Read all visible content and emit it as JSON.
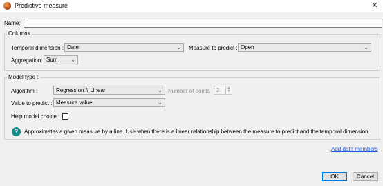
{
  "window": {
    "title": "Predictive measure",
    "close_glyph": "✕"
  },
  "name": {
    "label": "Name:",
    "value": ""
  },
  "columns": {
    "title": "Columns",
    "temporal_dimension_label": "Temporal dimension :",
    "temporal_dimension_value": "Date",
    "measure_to_predict_label": "Measure to predict :",
    "measure_to_predict_value": "Open",
    "aggregation_label": "Aggregation:",
    "aggregation_value": "Sum"
  },
  "model": {
    "title": "Model type :",
    "algorithm_label": "Algorithm :",
    "algorithm_value": "Regression // Linear",
    "points_label": "Number of points",
    "points_value": "2",
    "value_to_predict_label": "Value to predict :",
    "value_to_predict_value": "Measure value",
    "help_choice_label": "Help model choice :",
    "help_choice_checked": false,
    "help_text": "Approximates a given measure by a line. Use when there is a linear relationship between the measure to predict and the temporal dimension."
  },
  "footer": {
    "add_date_members": "Add date members",
    "ok_label": "OK",
    "cancel_label": "Cancel"
  },
  "icons": {
    "dropdown": "⌄",
    "spin_up": "▲",
    "spin_down": "▼",
    "help": "?"
  },
  "colors": {
    "link": "#1f5ad6",
    "help_icon": "#1a8a8a",
    "default_button_border": "#0078d7"
  }
}
